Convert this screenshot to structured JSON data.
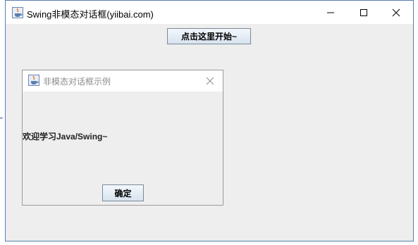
{
  "window": {
    "title": "Swing非模态对话框(yiibai.com)",
    "start_button_label": "点击这里开始~",
    "stray_mark": "\""
  },
  "icons": {
    "app": "java-cup-icon",
    "minimize": "minimize-icon",
    "maximize": "maximize-icon",
    "close": "close-icon"
  },
  "dialog": {
    "title": "非模态对话框示例",
    "message": "欢迎学习Java/Swing~",
    "ok_label": "确定"
  },
  "colors": {
    "window_background": "#eeeeee",
    "titlebar": "#ffffff",
    "button_gradient_top": "#f4f8fc",
    "button_gradient_bottom": "#d7e3ef",
    "dialog_title_text": "#8c8c8c"
  }
}
